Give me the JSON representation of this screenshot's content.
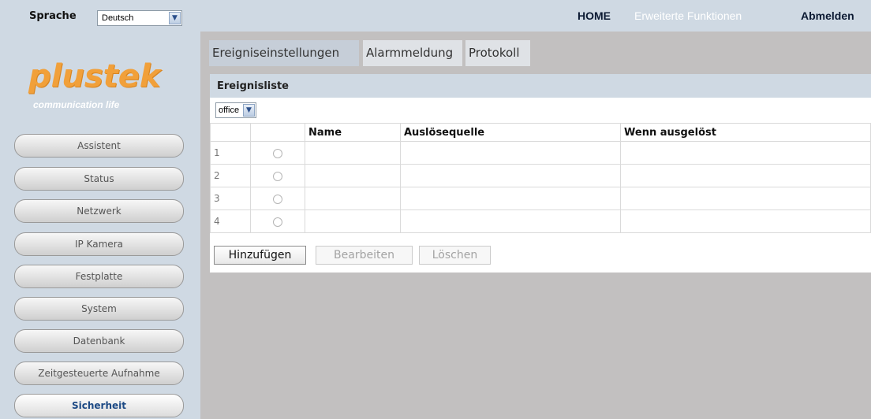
{
  "topbar": {
    "language_label": "Sprache",
    "language_value": "Deutsch",
    "nav_home": "HOME",
    "nav_extended": "Erweiterte Funktionen",
    "nav_logout": "Abmelden"
  },
  "logo": {
    "brand": "plustek",
    "tagline": "communication life"
  },
  "sidebar": {
    "items": [
      {
        "label": "Assistent"
      },
      {
        "label": "Status"
      },
      {
        "label": "Netzwerk"
      },
      {
        "label": "IP Kamera"
      },
      {
        "label": "Festplatte"
      },
      {
        "label": "System"
      },
      {
        "label": "Datenbank"
      },
      {
        "label": "Zeitgesteuerte Aufnahme"
      },
      {
        "label": "Sicherheit",
        "active": true
      }
    ]
  },
  "tabs": [
    {
      "label": "Ereigniseinstellungen",
      "active": true
    },
    {
      "label": "Alarmmeldung"
    },
    {
      "label": "Protokoll"
    }
  ],
  "events": {
    "title": "Ereignisliste",
    "filter_value": "office",
    "columns": [
      "",
      "",
      "Name",
      "Auslösequelle",
      "Wenn ausgelöst"
    ],
    "rows": [
      {
        "num": "1",
        "name": "",
        "source": "",
        "when": ""
      },
      {
        "num": "2",
        "name": "",
        "source": "",
        "when": ""
      },
      {
        "num": "3",
        "name": "",
        "source": "",
        "when": ""
      },
      {
        "num": "4",
        "name": "",
        "source": "",
        "when": ""
      }
    ],
    "buttons": {
      "add": "Hinzufügen",
      "edit": "Bearbeiten",
      "delete": "Löschen"
    }
  },
  "colors": {
    "header_bg": "#cfd9e3",
    "logo_orange": "#f1a03a",
    "content_bg": "#c2c0c0",
    "active_nav": "#1d4a85"
  }
}
